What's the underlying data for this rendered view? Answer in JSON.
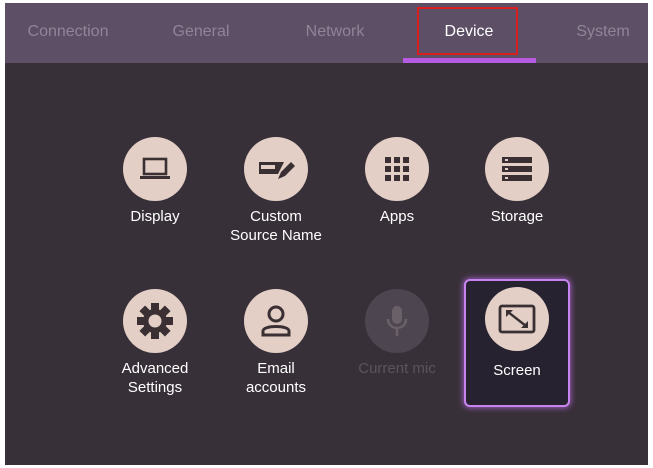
{
  "tabs": [
    {
      "label": "Connection",
      "active": false
    },
    {
      "label": "General",
      "active": false
    },
    {
      "label": "Network",
      "active": false
    },
    {
      "label": "Device",
      "active": true
    },
    {
      "label": "System",
      "active": false
    }
  ],
  "colors": {
    "background": "#383038",
    "tab_bar": "#5d5066",
    "accent": "#b45be0",
    "highlight_box": "#d81e1e",
    "icon_circle": "#e3cfc6",
    "icon_glyph": "#3a3033"
  },
  "tiles": [
    {
      "label": "Display",
      "icon": "laptop-icon",
      "state": "normal"
    },
    {
      "label": "Custom Source Name",
      "icon": "label-edit-icon",
      "state": "normal"
    },
    {
      "label": "Apps",
      "icon": "apps-grid-icon",
      "state": "normal"
    },
    {
      "label": "Storage",
      "icon": "storage-icon",
      "state": "normal"
    },
    {
      "label": "Advanced Settings",
      "icon": "gear-icon",
      "state": "normal"
    },
    {
      "label": "Email accounts",
      "icon": "person-icon",
      "state": "normal"
    },
    {
      "label": "Current mic",
      "icon": "microphone-icon",
      "state": "disabled"
    },
    {
      "label": "Screen",
      "icon": "screen-resize-icon",
      "state": "selected"
    }
  ]
}
